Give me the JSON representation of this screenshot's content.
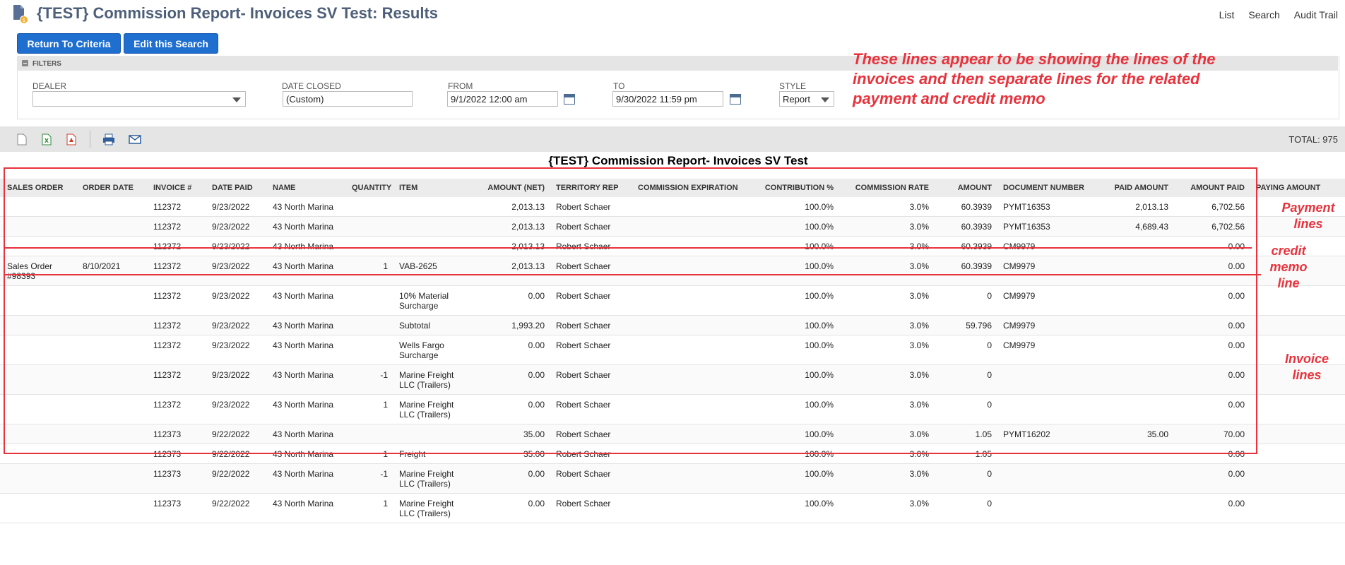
{
  "header": {
    "title": "{TEST} Commission Report- Invoices SV Test: Results",
    "links": [
      "List",
      "Search",
      "Audit Trail"
    ]
  },
  "buttons": {
    "return": "Return To Criteria",
    "edit": "Edit this Search"
  },
  "filters": {
    "section_label": "FILTERS",
    "dealer_label": "DEALER",
    "dealer_value": "",
    "date_closed_label": "DATE CLOSED",
    "date_closed_value": "(Custom)",
    "from_label": "FROM",
    "from_value": "9/1/2022 12:00 am",
    "to_label": "TO",
    "to_value": "9/30/2022 11:59 pm",
    "style_label": "STYLE",
    "style_value": "Report"
  },
  "annotations": {
    "main": "These lines appear to be showing the lines of the invoices and then separate lines for the related payment and credit memo",
    "payment": "Payment lines",
    "credit": "credit memo line",
    "invoice": "Invoice lines"
  },
  "toolbar": {
    "icons": [
      "document-icon",
      "excel-export-icon",
      "pdf-export-icon",
      "print-icon",
      "email-icon"
    ],
    "total": "TOTAL: 975"
  },
  "report": {
    "title": "{TEST} Commission Report- Invoices SV Test",
    "columns": [
      "SALES ORDER",
      "ORDER DATE",
      "INVOICE #",
      "DATE PAID",
      "NAME",
      "QUANTITY",
      "ITEM",
      "AMOUNT (NET)",
      "TERRITORY REP",
      "COMMISSION EXPIRATION",
      "CONTRIBUTION %",
      "COMMISSION RATE",
      "AMOUNT",
      "DOCUMENT NUMBER",
      "PAID AMOUNT",
      "AMOUNT PAID",
      "PAYING AMOUNT"
    ],
    "rows": [
      [
        "",
        "",
        "112372",
        "9/23/2022",
        "43 North Marina",
        "",
        "",
        "2,013.13",
        "Robert Schaer",
        "",
        "100.0%",
        "3.0%",
        "60.3939",
        "PYMT16353",
        "2,013.13",
        "6,702.56",
        ""
      ],
      [
        "",
        "",
        "112372",
        "9/23/2022",
        "43 North Marina",
        "",
        "",
        "2,013.13",
        "Robert Schaer",
        "",
        "100.0%",
        "3.0%",
        "60.3939",
        "PYMT16353",
        "4,689.43",
        "6,702.56",
        ""
      ],
      [
        "",
        "",
        "112372",
        "9/23/2022",
        "43 North Marina",
        "",
        "",
        "2,013.13",
        "Robert Schaer",
        "",
        "100.0%",
        "3.0%",
        "60.3939",
        "CM9979",
        "",
        "0.00",
        ""
      ],
      [
        "Sales Order #98393",
        "8/10/2021",
        "112372",
        "9/23/2022",
        "43 North Marina",
        "1",
        "VAB-2625",
        "2,013.13",
        "Robert Schaer",
        "",
        "100.0%",
        "3.0%",
        "60.3939",
        "CM9979",
        "",
        "0.00",
        ""
      ],
      [
        "",
        "",
        "112372",
        "9/23/2022",
        "43 North Marina",
        "",
        "10% Material Surcharge",
        "0.00",
        "Robert Schaer",
        "",
        "100.0%",
        "3.0%",
        "0",
        "CM9979",
        "",
        "0.00",
        ""
      ],
      [
        "",
        "",
        "112372",
        "9/23/2022",
        "43 North Marina",
        "",
        "Subtotal",
        "1,993.20",
        "Robert Schaer",
        "",
        "100.0%",
        "3.0%",
        "59.796",
        "CM9979",
        "",
        "0.00",
        ""
      ],
      [
        "",
        "",
        "112372",
        "9/23/2022",
        "43 North Marina",
        "",
        "Wells Fargo Surcharge",
        "0.00",
        "Robert Schaer",
        "",
        "100.0%",
        "3.0%",
        "0",
        "CM9979",
        "",
        "0.00",
        ""
      ],
      [
        "",
        "",
        "112372",
        "9/23/2022",
        "43 North Marina",
        "-1",
        "Marine Freight LLC (Trailers)",
        "0.00",
        "Robert Schaer",
        "",
        "100.0%",
        "3.0%",
        "0",
        "",
        "",
        "0.00",
        ""
      ],
      [
        "",
        "",
        "112372",
        "9/23/2022",
        "43 North Marina",
        "1",
        "Marine Freight LLC (Trailers)",
        "0.00",
        "Robert Schaer",
        "",
        "100.0%",
        "3.0%",
        "0",
        "",
        "",
        "0.00",
        ""
      ],
      [
        "",
        "",
        "112373",
        "9/22/2022",
        "43 North Marina",
        "",
        "",
        "35.00",
        "Robert Schaer",
        "",
        "100.0%",
        "3.0%",
        "1.05",
        "PYMT16202",
        "35.00",
        "70.00",
        ""
      ],
      [
        "",
        "",
        "112373",
        "9/22/2022",
        "43 North Marina",
        "1",
        "Freight",
        "35.00",
        "Robert Schaer",
        "",
        "100.0%",
        "3.0%",
        "1.05",
        "",
        "",
        "0.00",
        ""
      ],
      [
        "",
        "",
        "112373",
        "9/22/2022",
        "43 North Marina",
        "-1",
        "Marine Freight LLC (Trailers)",
        "0.00",
        "Robert Schaer",
        "",
        "100.0%",
        "3.0%",
        "0",
        "",
        "",
        "0.00",
        ""
      ],
      [
        "",
        "",
        "112373",
        "9/22/2022",
        "43 North Marina",
        "1",
        "Marine Freight LLC (Trailers)",
        "0.00",
        "Robert Schaer",
        "",
        "100.0%",
        "3.0%",
        "0",
        "",
        "",
        "0.00",
        ""
      ]
    ]
  }
}
